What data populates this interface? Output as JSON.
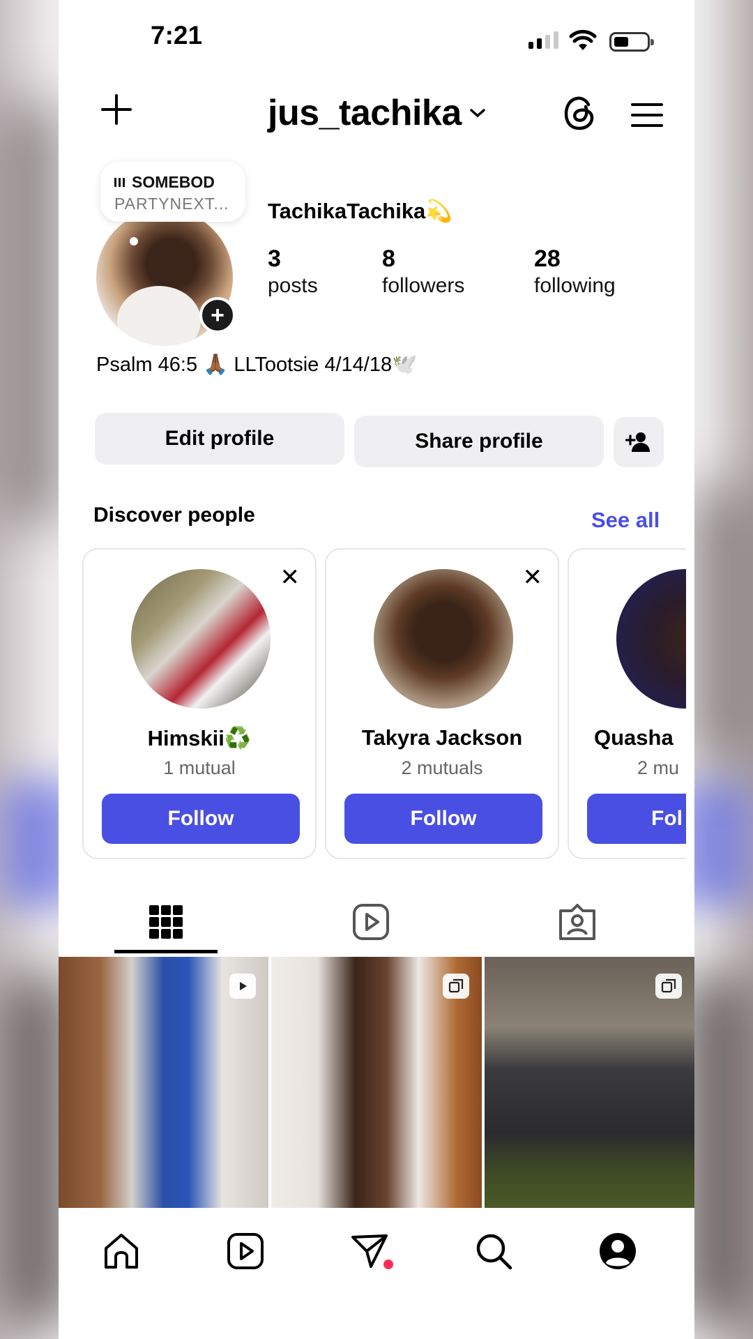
{
  "status_bar": {
    "time": "7:21"
  },
  "header": {
    "username": "jus_tachika"
  },
  "music_note": {
    "song": "SOMEBOD",
    "artist": "PARTYNEXT..."
  },
  "profile": {
    "display_name": "TachikaTachika",
    "display_emoji": "💫",
    "posts_count": "3",
    "posts_label": "posts",
    "followers_count": "8",
    "followers_label": "followers",
    "following_count": "28",
    "following_label": "following",
    "bio_text_1": "Psalm 46:5",
    "bio_emoji_1": "🙏🏾",
    "bio_text_2": "LLTootsie 4/14/18",
    "bio_emoji_2": "🕊️"
  },
  "actions": {
    "edit_label": "Edit profile",
    "share_label": "Share profile"
  },
  "discover": {
    "title": "Discover people",
    "see_all": "See all",
    "cards": [
      {
        "name": "Himskii♻️",
        "mutual": "1 mutual",
        "follow": "Follow"
      },
      {
        "name": "Takyra Jackson",
        "mutual": "2 mutuals",
        "follow": "Follow"
      },
      {
        "name": "Quasha",
        "mutual": "2 mu",
        "follow": "Fol"
      }
    ]
  },
  "colors": {
    "accent": "#4a4fe3",
    "button_gray": "#efeff1",
    "notification": "#ff2d55"
  },
  "icons": {
    "top_left": "plus-icon",
    "top_right": [
      "threads-icon",
      "menu-icon"
    ],
    "tabs": [
      "grid-icon",
      "reels-icon",
      "tagged-icon"
    ],
    "bottom_nav": [
      "home-icon",
      "reels-icon",
      "send-icon",
      "search-icon",
      "profile-icon"
    ]
  }
}
